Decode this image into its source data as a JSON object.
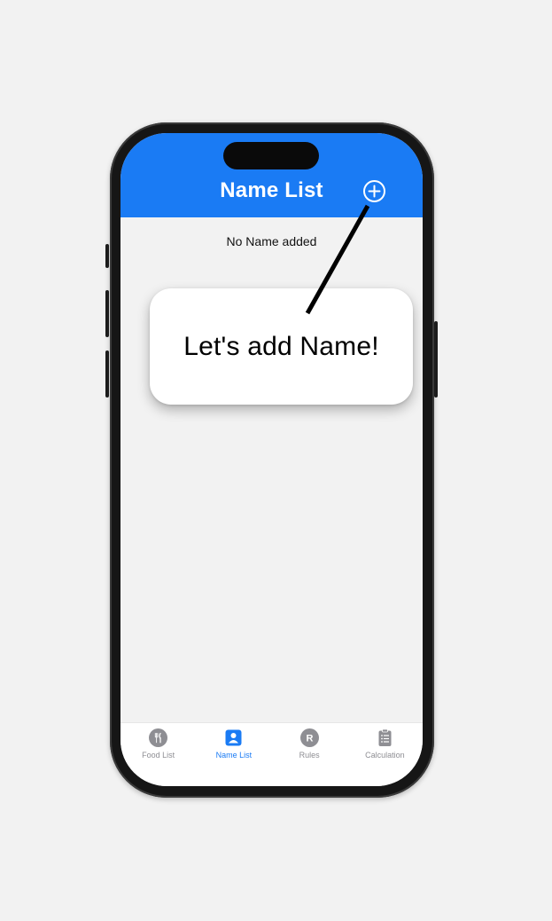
{
  "header": {
    "title": "Name List",
    "add_icon": "plus-circle-icon"
  },
  "empty_state": {
    "text": "No Name added"
  },
  "callout": {
    "text": "Let's add Name!"
  },
  "tabs": [
    {
      "label": "Food List",
      "icon": "fork-knife-icon",
      "active": false
    },
    {
      "label": "Name List",
      "icon": "person-icon",
      "active": true
    },
    {
      "label": "Rules",
      "icon": "letter-r-icon",
      "active": false
    },
    {
      "label": "Calculation",
      "icon": "clipboard-list-icon",
      "active": false
    }
  ],
  "colors": {
    "accent": "#1a7bf4",
    "inactive": "#8e8e93",
    "background": "#f2f2f2"
  }
}
